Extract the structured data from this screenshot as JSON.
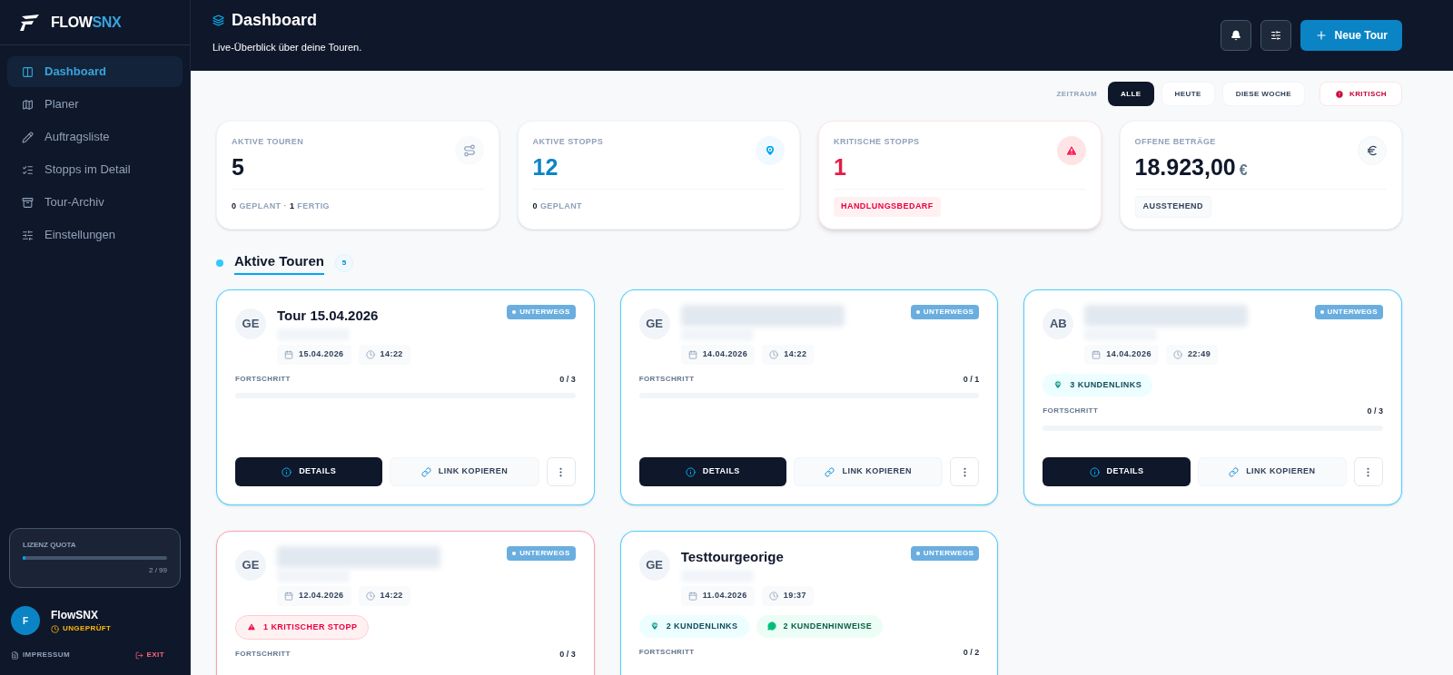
{
  "sidebar": {
    "logo": {
      "part1": "FLOW",
      "part2": "SNX"
    },
    "items": [
      {
        "label": "Dashboard",
        "selected": true
      },
      {
        "label": "Planer",
        "selected": false
      },
      {
        "label": "Auftragsliste",
        "selected": false
      },
      {
        "label": "Stopps im Detail",
        "selected": false
      },
      {
        "label": "Tour-Archiv",
        "selected": false
      },
      {
        "label": "Einstellungen",
        "selected": false
      }
    ],
    "quota": {
      "label": "LIZENZ QUOTA",
      "level": 0.02,
      "reading": "2 / 99"
    },
    "user": {
      "avatar": "F",
      "name": "FlowSNX",
      "status": "UNGEPRÜFT"
    },
    "footer": {
      "impressum": "IMPRESSUM",
      "exit": "EXIT"
    }
  },
  "header": {
    "title": "Dashboard",
    "subtitle": "Live-Überblick über deine Touren.",
    "primary_button": "Neue Tour"
  },
  "filters": {
    "label": "ZEITRAUM",
    "options": [
      {
        "label": "ALLE",
        "selected": true
      },
      {
        "label": "HEUTE",
        "selected": false
      },
      {
        "label": "DIESE WOCHE",
        "selected": false
      }
    ],
    "critical": "KRITISCH"
  },
  "stats": [
    {
      "kind": "tours",
      "label": "AKTIVE TOUREN",
      "value": "5",
      "footer": "**0** GEPLANT · **1** FERTIG"
    },
    {
      "kind": "stops",
      "label": "AKTIVE STOPPS",
      "value": "12",
      "footer": "**0** GEPLANT"
    },
    {
      "kind": "critical",
      "label": "KRITISCHE STOPPS",
      "value": "1",
      "badge": "HANDLUNGSBEDARF"
    },
    {
      "kind": "amount",
      "label": "OFFENE BETRÄGE",
      "value": "18.923,00",
      "unit": "€",
      "badge": "AUSSTEHEND"
    }
  ],
  "section": {
    "title": "Aktive Touren",
    "count": "5"
  },
  "tours": [
    {
      "initials": "GE",
      "title": "Tour 15.04.2026",
      "status": "UNTERWEGS",
      "date": "15.04.2026",
      "time": "14:22",
      "critical": false,
      "progress_label": "FORTSCHRITT",
      "progress": "0 / 3",
      "level": 0,
      "details": "DETAILS",
      "copy": "LINK KOPIEREN"
    },
    {
      "initials": "GE",
      "status": "UNTERWEGS",
      "date": "14.04.2026",
      "time": "14:22",
      "critical": false,
      "progress_label": "FORTSCHRITT",
      "progress": "0 / 1",
      "level": 0,
      "details": "DETAILS",
      "copy": "LINK KOPIEREN"
    },
    {
      "initials": "AB",
      "status": "UNTERWEGS",
      "date": "14.04.2026",
      "time": "22:49",
      "critical": false,
      "chips": [
        {
          "kind": "links",
          "text": "3 KUNDENLINKS"
        }
      ],
      "progress_label": "FORTSCHRITT",
      "progress": "0 / 3",
      "level": 0,
      "details": "DETAILS",
      "copy": "LINK KOPIEREN"
    },
    {
      "initials": "GE",
      "status": "UNTERWEGS",
      "date": "12.04.2026",
      "time": "14:22",
      "critical": true,
      "chips": [
        {
          "kind": "critical",
          "text": "1 KRITISCHER STOPP"
        }
      ],
      "progress_label": "FORTSCHRITT",
      "progress": "0 / 3"
    },
    {
      "initials": "GE",
      "title": "Testtourgeorige",
      "status": "UNTERWEGS",
      "date": "11.04.2026",
      "time": "19:37",
      "critical": false,
      "chips": [
        {
          "kind": "links",
          "text": "2 KUNDENLINKS"
        },
        {
          "kind": "hints",
          "text": "2 KUNDENHINWEISE"
        }
      ],
      "progress_label": "FORTSCHRITT",
      "progress": "0 / 2"
    }
  ]
}
